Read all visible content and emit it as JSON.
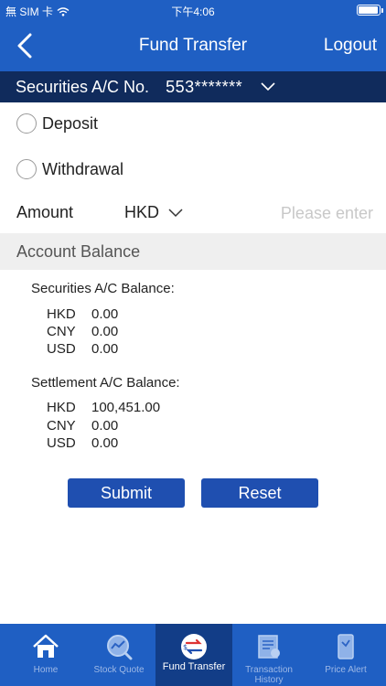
{
  "status_bar": {
    "carrier": "無 SIM 卡",
    "time": "下午4:06"
  },
  "nav": {
    "title": "Fund Transfer",
    "logout_label": "Logout"
  },
  "account": {
    "label": "Securities A/C No.",
    "number": "553*******"
  },
  "transfer_type": {
    "options": [
      {
        "label": "Deposit",
        "selected": false
      },
      {
        "label": "Withdrawal",
        "selected": false
      }
    ]
  },
  "amount": {
    "label": "Amount",
    "currency": "HKD",
    "value": "",
    "placeholder": "Please enter"
  },
  "balance": {
    "header": "Account Balance",
    "securities": {
      "title": "Securities A/C Balance:",
      "rows": [
        {
          "currency": "HKD",
          "value": "0.00"
        },
        {
          "currency": "CNY",
          "value": "0.00"
        },
        {
          "currency": "USD",
          "value": "0.00"
        }
      ]
    },
    "settlement": {
      "title": "Settlement A/C Balance:",
      "rows": [
        {
          "currency": "HKD",
          "value": "100,451.00"
        },
        {
          "currency": "CNY",
          "value": "0.00"
        },
        {
          "currency": "USD",
          "value": "0.00"
        }
      ]
    }
  },
  "actions": {
    "submit_label": "Submit",
    "reset_label": "Reset"
  },
  "tabbar": {
    "tabs": [
      {
        "label": "Home",
        "icon": "home-icon",
        "active": false
      },
      {
        "label": "Stock Quote",
        "icon": "stock-quote-icon",
        "active": false
      },
      {
        "label": "Fund Transfer",
        "icon": "fund-transfer-icon",
        "active": true
      },
      {
        "label": "Transaction History",
        "icon": "transaction-history-icon",
        "active": false
      },
      {
        "label": "Price Alert",
        "icon": "price-alert-icon",
        "active": false
      }
    ]
  },
  "colors": {
    "header_blue": "#1f5fc3",
    "account_bar_navy": "#102b5c",
    "button_blue": "#1f4fb0",
    "active_tab": "#123d87"
  }
}
